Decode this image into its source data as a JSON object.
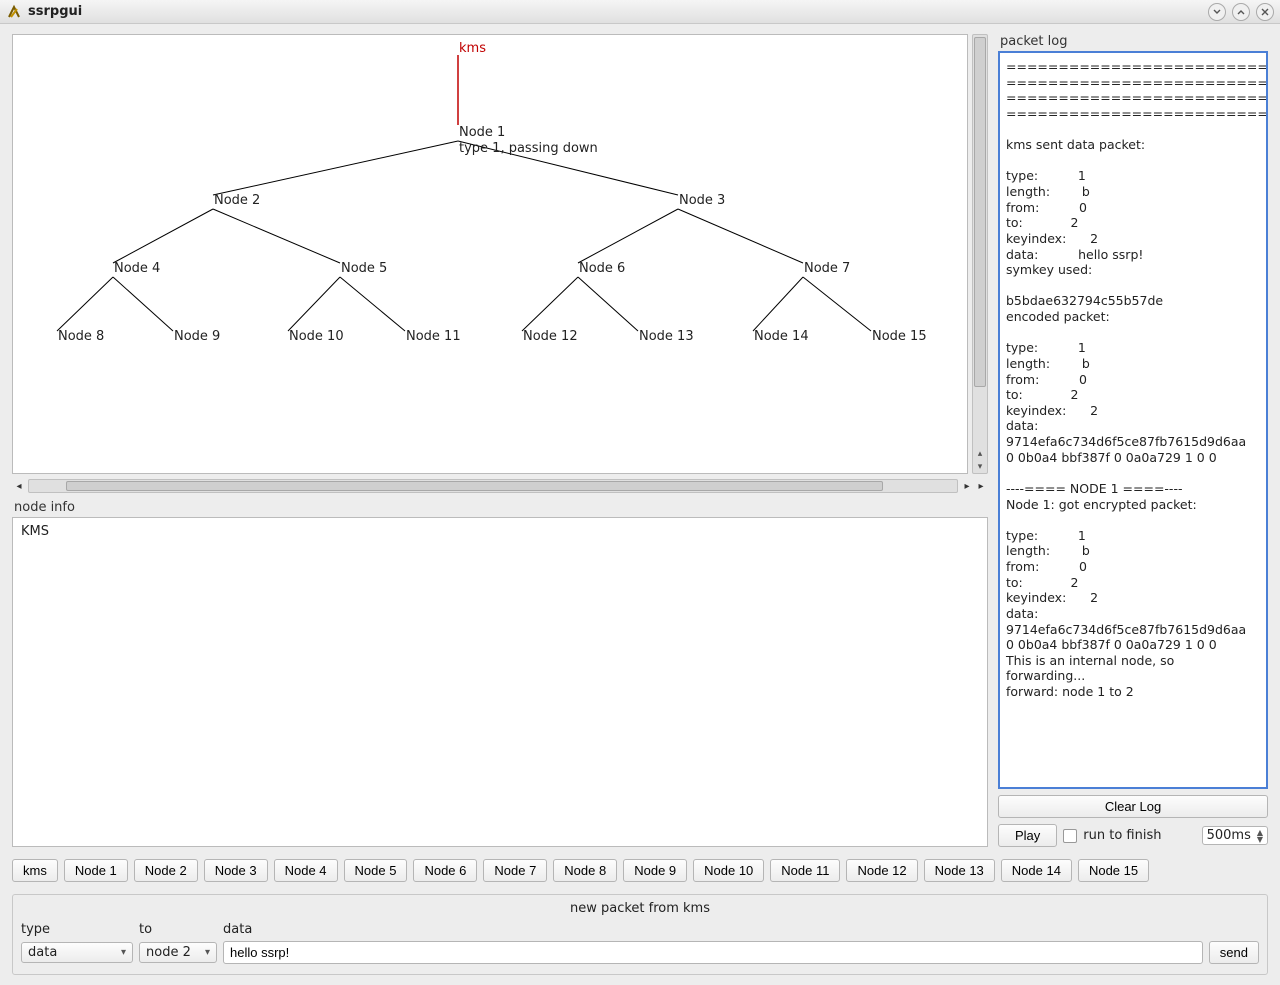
{
  "window": {
    "title": "ssrpgui"
  },
  "tree": {
    "root_label": "kms",
    "node1_label": "Node 1",
    "node1_sub": "type 1, passing down",
    "nodes": {
      "n2": "Node 2",
      "n3": "Node 3",
      "n4": "Node 4",
      "n5": "Node 5",
      "n6": "Node 6",
      "n7": "Node 7",
      "n8": "Node 8",
      "n9": "Node 9",
      "n10": "Node 10",
      "n11": "Node 11",
      "n12": "Node 12",
      "n13": "Node 13",
      "n14": "Node 14",
      "n15": "Node 15"
    }
  },
  "nodeinfo": {
    "label": "node info",
    "content": "KMS"
  },
  "packetlog": {
    "label": "packet log",
    "content": "=============================\n=========================\n=============================\n=========================\n\nkms sent data packet:\n\ntype:          1\nlength:        b\nfrom:          0\nto:            2\nkeyindex:      2\ndata:          hello ssrp!\nsymkey used:\n\nb5bdae632794c55b57de\nencoded packet:\n\ntype:          1\nlength:        b\nfrom:          0\nto:            2\nkeyindex:      2\ndata:\n9714efa6c734d6f5ce87fb7615d9d6aa\n0 0b0a4 bbf387f 0 0a0a729 1 0 0\n\n----==== NODE 1 ====----\nNode 1: got encrypted packet:\n\ntype:          1\nlength:        b\nfrom:          0\nto:            2\nkeyindex:      2\ndata:\n9714efa6c734d6f5ce87fb7615d9d6aa\n0 0b0a4 bbf387f 0 0a0a729 1 0 0\nThis is an internal node, so\nforwarding...\nforward: node 1 to 2",
    "clear_label": "Clear Log",
    "play_label": "Play",
    "run_label": "run to finish",
    "interval": "500ms"
  },
  "node_buttons": [
    "kms",
    "Node 1",
    "Node 2",
    "Node 3",
    "Node 4",
    "Node 5",
    "Node 6",
    "Node 7",
    "Node 8",
    "Node 9",
    "Node 10",
    "Node 11",
    "Node 12",
    "Node 13",
    "Node 14",
    "Node 15"
  ],
  "packet_form": {
    "title": "new packet from kms",
    "labels": {
      "type": "type",
      "to": "to",
      "data": "data"
    },
    "type_value": "data",
    "to_value": "node 2",
    "data_value": "hello ssrp!",
    "send_label": "send"
  }
}
